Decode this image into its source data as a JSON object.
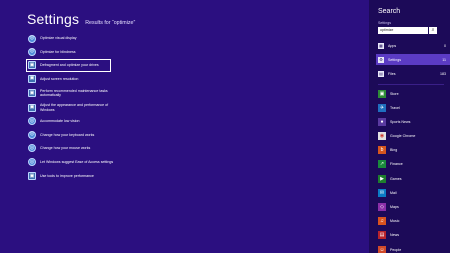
{
  "header": {
    "title": "Settings",
    "subtitle": "Results for “optimize”"
  },
  "results": [
    {
      "label": "Optimize visual display",
      "icon": "accessibility-icon",
      "lines": 1
    },
    {
      "label": "Optimize for blindness",
      "icon": "accessibility-icon",
      "lines": 1
    },
    {
      "label": "Defragment and optimize your drives",
      "icon": "defrag-icon",
      "lines": 1,
      "selected": true
    },
    {
      "label": "Adjust screen resolution",
      "icon": "display-icon",
      "lines": 1
    },
    {
      "label": "Perform recommended maintenance tasks automatically",
      "icon": "maintenance-flag-icon",
      "lines": 2
    },
    {
      "label": "Adjust the appearance and performance of Windows",
      "icon": "system-icon",
      "lines": 2
    },
    {
      "label": "Accommodate low vision",
      "icon": "accessibility-icon",
      "lines": 1
    },
    {
      "label": "Change how your keyboard works",
      "icon": "accessibility-icon",
      "lines": 1
    },
    {
      "label": "Change how your mouse works",
      "icon": "accessibility-icon",
      "lines": 1
    },
    {
      "label": "Let Windows suggest Ease of Access settings",
      "icon": "accessibility-icon",
      "lines": 2
    },
    {
      "label": "Use tools to improve performance",
      "icon": "performance-icon",
      "lines": 1
    }
  ],
  "pane": {
    "title": "Search",
    "subtitle": "Settings",
    "query": "optimize",
    "search_button": "⌕",
    "scopes": [
      {
        "name": "Apps",
        "count": "0",
        "icon": "apps-icon"
      },
      {
        "name": "Settings",
        "count": "11",
        "icon": "gear-icon",
        "active": true
      },
      {
        "name": "Files",
        "count": "183",
        "icon": "files-icon"
      }
    ],
    "apps": [
      {
        "name": "Store",
        "color": "#2e8b37",
        "icon": "store-icon"
      },
      {
        "name": "Travel",
        "color": "#1f6fbf",
        "icon": "travel-icon"
      },
      {
        "name": "Sports News",
        "color": "#5a3aa0",
        "icon": "sports-icon"
      },
      {
        "name": "Google Chrome",
        "color": "#e2e2e2",
        "icon": "chrome-icon"
      },
      {
        "name": "Bing",
        "color": "#d6561e",
        "icon": "bing-icon"
      },
      {
        "name": "Finance",
        "color": "#1a8a3c",
        "icon": "finance-icon"
      },
      {
        "name": "Games",
        "color": "#1e7d2d",
        "icon": "games-icon"
      },
      {
        "name": "Mail",
        "color": "#0b7bc5",
        "icon": "mail-icon"
      },
      {
        "name": "Maps",
        "color": "#8b2fa8",
        "icon": "maps-icon"
      },
      {
        "name": "Music",
        "color": "#d9531e",
        "icon": "music-icon"
      },
      {
        "name": "News",
        "color": "#b8242c",
        "icon": "news-icon"
      },
      {
        "name": "People",
        "color": "#d04a2a",
        "icon": "people-icon"
      }
    ]
  }
}
